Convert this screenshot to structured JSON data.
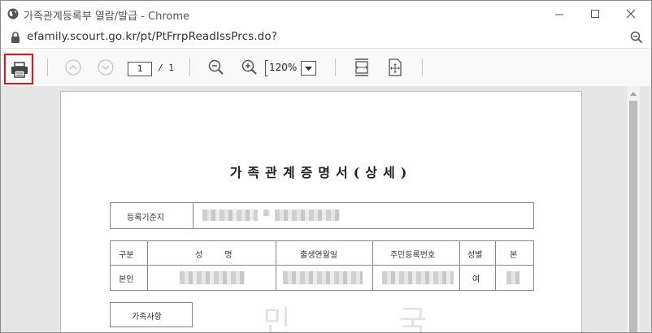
{
  "window": {
    "title": "가족관계등록부 열람/발급 - Chrome",
    "buttons": [
      "minimize",
      "maximize",
      "close"
    ]
  },
  "address_bar": {
    "url": "efamily.scourt.go.kr/pt/PtFrrpReadIssPrcs.do?"
  },
  "pdf_toolbar": {
    "page_current": "1",
    "page_total": "/ 1",
    "zoom": "120%",
    "icons": [
      "printer-icon",
      "page-up-icon",
      "page-down-icon",
      "zoom-out-icon",
      "zoom-in-icon",
      "fit-width-icon",
      "fit-page-icon"
    ]
  },
  "document": {
    "title": "가족관계증명서(상세)",
    "registration_label": "등록기준지",
    "table_headers": [
      "구분",
      "성 명",
      "출생연월일",
      "주민등록번호",
      "성별",
      "본"
    ],
    "person_row": {
      "category": "본인",
      "gender": "여"
    },
    "section_label": "가족사항",
    "watermark": "민 국"
  },
  "colors": {
    "highlight": "#e01818",
    "toolbar_bg": "#f9f9f9",
    "viewer_bg": "#e6e6e6"
  }
}
